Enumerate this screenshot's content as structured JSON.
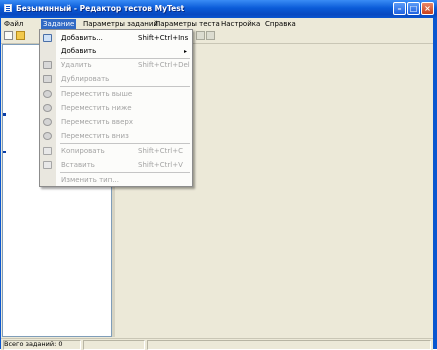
{
  "window": {
    "title": "Безымянный - Редактор тестов MyTest"
  },
  "menubar": {
    "items": [
      {
        "label": "Файл"
      },
      {
        "label": "Задание"
      },
      {
        "label": "Параметры заданий"
      },
      {
        "label": "Параметры теста"
      },
      {
        "label": "Настройка"
      },
      {
        "label": "Справка"
      }
    ]
  },
  "task_menu": {
    "add_dialog": {
      "label": "Добавить...",
      "shortcut": "Shift+Ctrl+Ins"
    },
    "add_submenu": {
      "label": "Добавить",
      "arrow": "▸"
    },
    "delete": {
      "label": "Удалить",
      "shortcut": "Shift+Ctrl+Del"
    },
    "duplicate": {
      "label": "Дублировать"
    },
    "move_up": {
      "label": "Переместить выше"
    },
    "move_down": {
      "label": "Переместить ниже"
    },
    "move_top": {
      "label": "Переместить вверх"
    },
    "move_bottom": {
      "label": "Переместить вниз"
    },
    "copy": {
      "label": "Копировать",
      "shortcut": "Shift+Ctrl+C"
    },
    "paste": {
      "label": "Вставить",
      "shortcut": "Shift+Ctrl+V"
    },
    "change_type": {
      "label": "Изменить тип..."
    }
  },
  "statusbar": {
    "tasks_total": "Всего заданий: 0"
  },
  "icons": {
    "new": "new-document-icon",
    "open": "open-folder-icon",
    "add": "add-task-icon"
  },
  "colors": {
    "titlebar": "#0a56d0",
    "menu_highlight": "#316ac5",
    "window_face": "#ece9d8"
  }
}
